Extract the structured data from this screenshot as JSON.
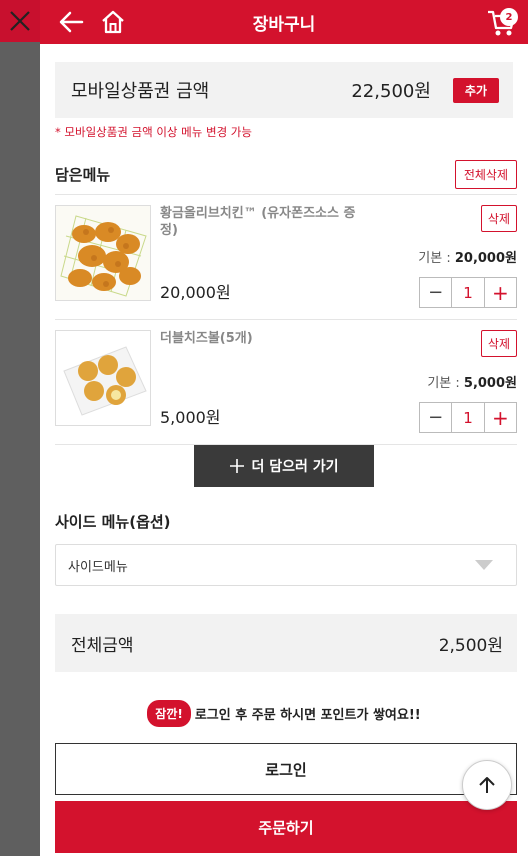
{
  "header": {
    "title": "장바구니",
    "cart_count": "2"
  },
  "voucher": {
    "label": "모바일상품권 금액",
    "amount": "22,500원",
    "add_label": "추가",
    "notice": "* 모바일상품권 금액 이상 메뉴 변경 가능"
  },
  "cart": {
    "title": "담은메뉴",
    "delete_all_label": "전체삭제",
    "items": [
      {
        "name": "황금올리브치킨™ (유자폰즈소스 증정)",
        "price": "20,000원",
        "delete_label": "삭제",
        "base_label": "기본 : ",
        "base_price": "20,000원",
        "qty": "1"
      },
      {
        "name": "더블치즈볼(5개)",
        "price": "5,000원",
        "delete_label": "삭제",
        "base_label": "기본 : ",
        "base_price": "5,000원",
        "qty": "1"
      }
    ],
    "more_label": "더 담으러 가기"
  },
  "side": {
    "title": "사이드 메뉴(옵션)",
    "selected": "사이드메뉴"
  },
  "total": {
    "label": "전체금액",
    "amount": "2,500원"
  },
  "point": {
    "tag": "잠깐!",
    "message": "로그인 후 주문 하시면 포인트가 쌓여요!!"
  },
  "actions": {
    "login_label": "로그인",
    "order_label": "주문하기"
  },
  "colors": {
    "brand_red": "#d3122d"
  }
}
